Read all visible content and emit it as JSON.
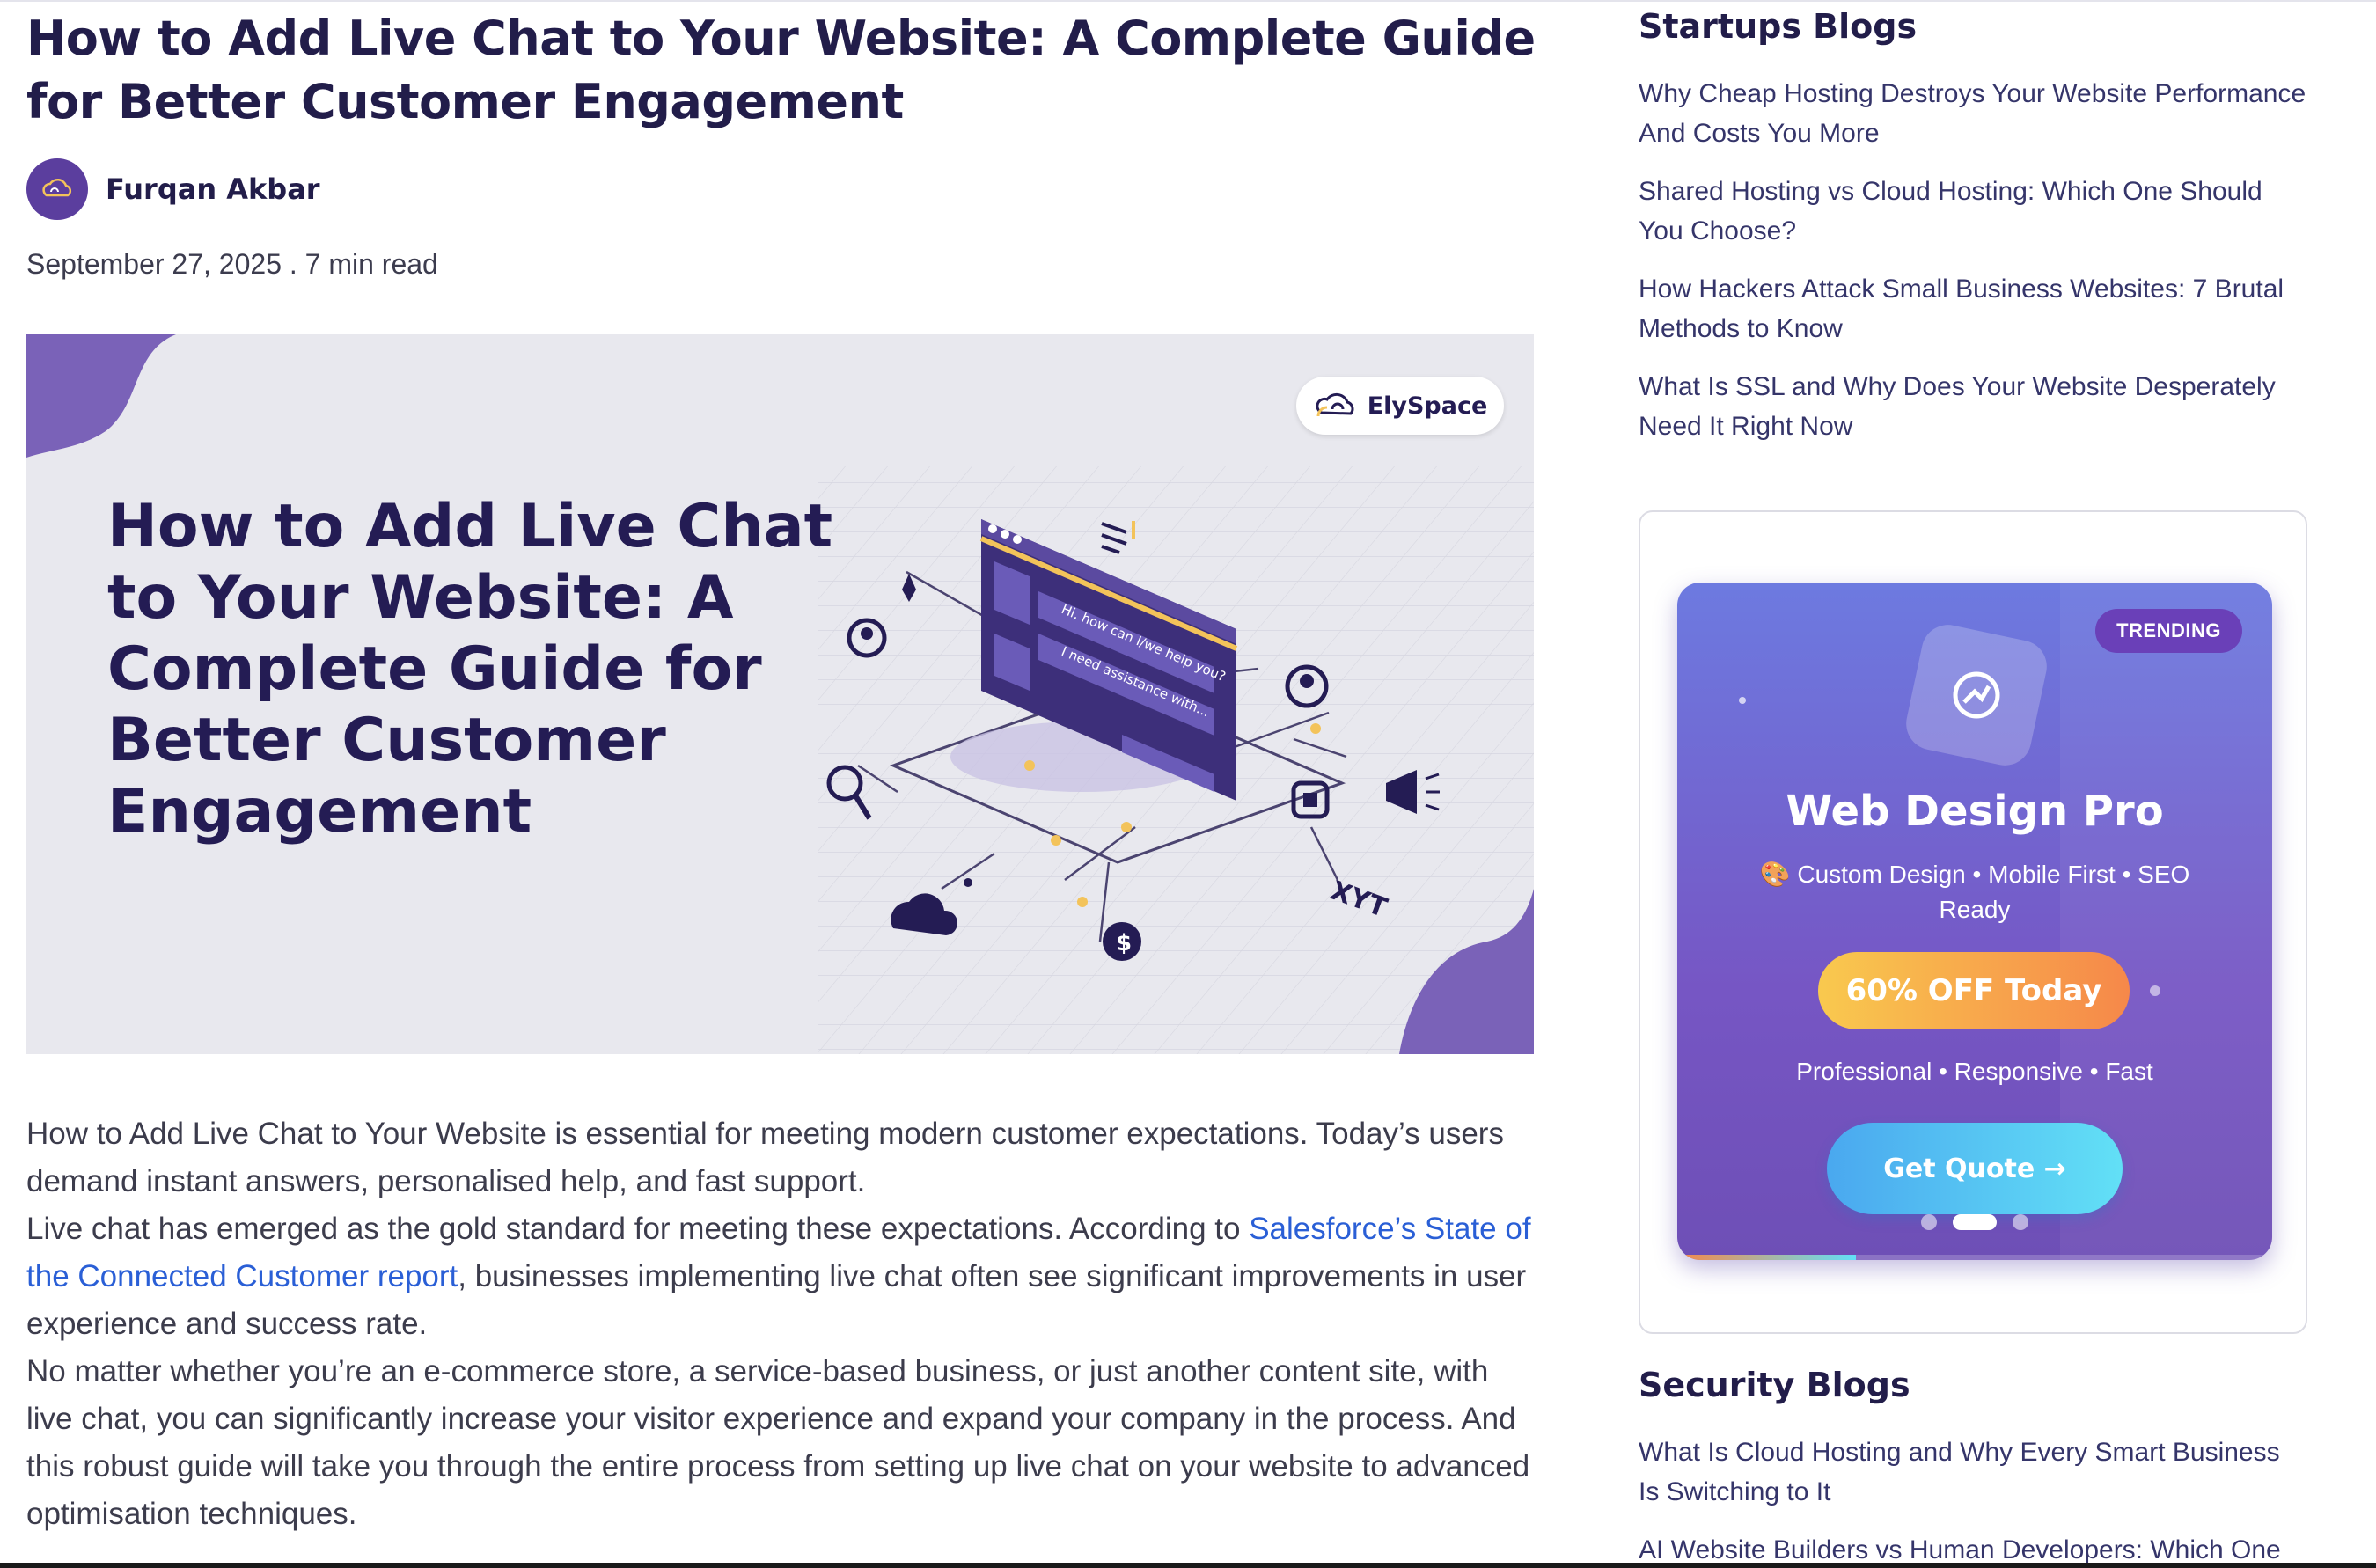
{
  "article": {
    "title": "How to Add Live Chat to Your Website: A Complete Guide for Better Customer Engagement",
    "author": "Furqan Akbar",
    "meta": "September 27, 2025 . 7 min read",
    "hero": {
      "title": "How to Add Live Chat to Your Website: A Complete Guide for Better Customer Engagement",
      "brand": "ElySpace",
      "bubble_1": "Hi, how can I/we help you?",
      "bubble_2": "I need assistance with...",
      "side_label": "XYT"
    },
    "paragraph_1": "How to Add Live Chat to Your Website is essential for meeting modern customer expectations. Today’s users demand instant answers, personalised help, and fast support.",
    "paragraph_2_before": "Live chat has emerged as the gold standard for meeting these expectations. According to ",
    "paragraph_2_link": "Salesforce’s State of the Connected Customer report",
    "paragraph_2_after": ", businesses implementing live chat often see significant improvements in user experience and success rate.",
    "paragraph_3": "No matter whether you’re an e-commerce store, a service-based business, or just another content site, with live chat, you can significantly increase your visitor experience and expand your company in the process. And this robust guide will take you through the entire process from setting up live chat on your website to advanced optimisation techniques."
  },
  "sidebar": {
    "startups_title": "Startups Blogs",
    "startups_links": [
      "Why Cheap Hosting Destroys Your Website Performance And Costs You More",
      "Shared Hosting vs Cloud Hosting: Which One Should You Choose?",
      "How Hackers Attack Small Business Websites: 7 Brutal Methods to Know",
      "What Is SSL and Why Does Your Website Desperately Need It Right Now"
    ],
    "promo": {
      "badge": "TRENDING",
      "title": "Web Design Pro",
      "features": "🎨 Custom Design • Mobile First • SEO Ready",
      "discount": "60% OFF Today",
      "tagline": "Professional • Responsive • Fast",
      "cta": "Get Quote →",
      "slides_total": 3,
      "slide_active": 2,
      "progress": 0.3
    },
    "security_title": "Security Blogs",
    "security_links": [
      "What Is Cloud Hosting and Why Every Smart Business Is Switching to It",
      "AI Website Builders vs Human Developers: Which One"
    ]
  },
  "colors": {
    "heading": "#221d4a",
    "link": "#2a5fd6",
    "brand_purple": "#5b3e9e",
    "promo_gradient_start": "#6d7ae0",
    "promo_gradient_end": "#6e4fb6"
  },
  "icons": [
    "elyspace-logo-icon",
    "chat-window-icon",
    "user-icon",
    "search-icon",
    "megaphone-icon",
    "dollar-icon",
    "cloud-icon",
    "analytics-icon"
  ]
}
